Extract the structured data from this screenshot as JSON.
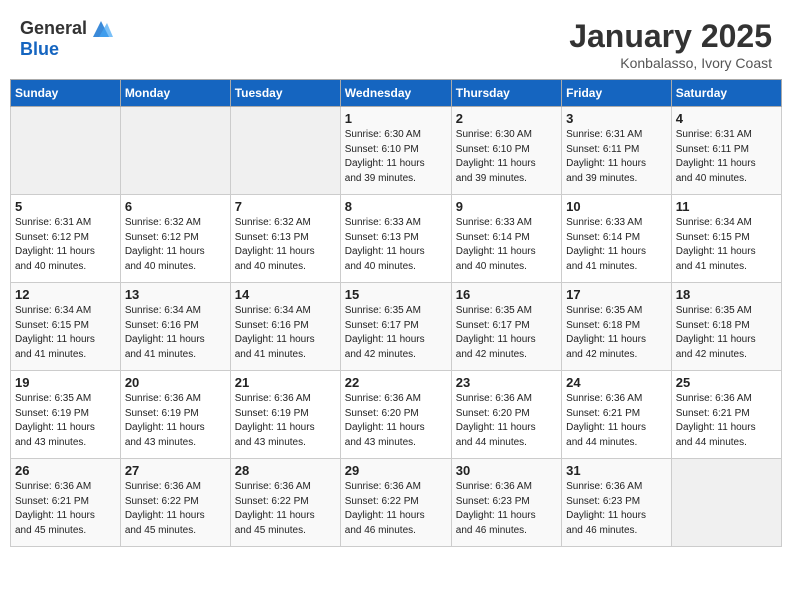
{
  "header": {
    "logo_general": "General",
    "logo_blue": "Blue",
    "month": "January 2025",
    "location": "Konbalasso, Ivory Coast"
  },
  "weekdays": [
    "Sunday",
    "Monday",
    "Tuesday",
    "Wednesday",
    "Thursday",
    "Friday",
    "Saturday"
  ],
  "weeks": [
    [
      {
        "day": "",
        "detail": ""
      },
      {
        "day": "",
        "detail": ""
      },
      {
        "day": "",
        "detail": ""
      },
      {
        "day": "1",
        "detail": "Sunrise: 6:30 AM\nSunset: 6:10 PM\nDaylight: 11 hours\nand 39 minutes."
      },
      {
        "day": "2",
        "detail": "Sunrise: 6:30 AM\nSunset: 6:10 PM\nDaylight: 11 hours\nand 39 minutes."
      },
      {
        "day": "3",
        "detail": "Sunrise: 6:31 AM\nSunset: 6:11 PM\nDaylight: 11 hours\nand 39 minutes."
      },
      {
        "day": "4",
        "detail": "Sunrise: 6:31 AM\nSunset: 6:11 PM\nDaylight: 11 hours\nand 40 minutes."
      }
    ],
    [
      {
        "day": "5",
        "detail": "Sunrise: 6:31 AM\nSunset: 6:12 PM\nDaylight: 11 hours\nand 40 minutes."
      },
      {
        "day": "6",
        "detail": "Sunrise: 6:32 AM\nSunset: 6:12 PM\nDaylight: 11 hours\nand 40 minutes."
      },
      {
        "day": "7",
        "detail": "Sunrise: 6:32 AM\nSunset: 6:13 PM\nDaylight: 11 hours\nand 40 minutes."
      },
      {
        "day": "8",
        "detail": "Sunrise: 6:33 AM\nSunset: 6:13 PM\nDaylight: 11 hours\nand 40 minutes."
      },
      {
        "day": "9",
        "detail": "Sunrise: 6:33 AM\nSunset: 6:14 PM\nDaylight: 11 hours\nand 40 minutes."
      },
      {
        "day": "10",
        "detail": "Sunrise: 6:33 AM\nSunset: 6:14 PM\nDaylight: 11 hours\nand 41 minutes."
      },
      {
        "day": "11",
        "detail": "Sunrise: 6:34 AM\nSunset: 6:15 PM\nDaylight: 11 hours\nand 41 minutes."
      }
    ],
    [
      {
        "day": "12",
        "detail": "Sunrise: 6:34 AM\nSunset: 6:15 PM\nDaylight: 11 hours\nand 41 minutes."
      },
      {
        "day": "13",
        "detail": "Sunrise: 6:34 AM\nSunset: 6:16 PM\nDaylight: 11 hours\nand 41 minutes."
      },
      {
        "day": "14",
        "detail": "Sunrise: 6:34 AM\nSunset: 6:16 PM\nDaylight: 11 hours\nand 41 minutes."
      },
      {
        "day": "15",
        "detail": "Sunrise: 6:35 AM\nSunset: 6:17 PM\nDaylight: 11 hours\nand 42 minutes."
      },
      {
        "day": "16",
        "detail": "Sunrise: 6:35 AM\nSunset: 6:17 PM\nDaylight: 11 hours\nand 42 minutes."
      },
      {
        "day": "17",
        "detail": "Sunrise: 6:35 AM\nSunset: 6:18 PM\nDaylight: 11 hours\nand 42 minutes."
      },
      {
        "day": "18",
        "detail": "Sunrise: 6:35 AM\nSunset: 6:18 PM\nDaylight: 11 hours\nand 42 minutes."
      }
    ],
    [
      {
        "day": "19",
        "detail": "Sunrise: 6:35 AM\nSunset: 6:19 PM\nDaylight: 11 hours\nand 43 minutes."
      },
      {
        "day": "20",
        "detail": "Sunrise: 6:36 AM\nSunset: 6:19 PM\nDaylight: 11 hours\nand 43 minutes."
      },
      {
        "day": "21",
        "detail": "Sunrise: 6:36 AM\nSunset: 6:19 PM\nDaylight: 11 hours\nand 43 minutes."
      },
      {
        "day": "22",
        "detail": "Sunrise: 6:36 AM\nSunset: 6:20 PM\nDaylight: 11 hours\nand 43 minutes."
      },
      {
        "day": "23",
        "detail": "Sunrise: 6:36 AM\nSunset: 6:20 PM\nDaylight: 11 hours\nand 44 minutes."
      },
      {
        "day": "24",
        "detail": "Sunrise: 6:36 AM\nSunset: 6:21 PM\nDaylight: 11 hours\nand 44 minutes."
      },
      {
        "day": "25",
        "detail": "Sunrise: 6:36 AM\nSunset: 6:21 PM\nDaylight: 11 hours\nand 44 minutes."
      }
    ],
    [
      {
        "day": "26",
        "detail": "Sunrise: 6:36 AM\nSunset: 6:21 PM\nDaylight: 11 hours\nand 45 minutes."
      },
      {
        "day": "27",
        "detail": "Sunrise: 6:36 AM\nSunset: 6:22 PM\nDaylight: 11 hours\nand 45 minutes."
      },
      {
        "day": "28",
        "detail": "Sunrise: 6:36 AM\nSunset: 6:22 PM\nDaylight: 11 hours\nand 45 minutes."
      },
      {
        "day": "29",
        "detail": "Sunrise: 6:36 AM\nSunset: 6:22 PM\nDaylight: 11 hours\nand 46 minutes."
      },
      {
        "day": "30",
        "detail": "Sunrise: 6:36 AM\nSunset: 6:23 PM\nDaylight: 11 hours\nand 46 minutes."
      },
      {
        "day": "31",
        "detail": "Sunrise: 6:36 AM\nSunset: 6:23 PM\nDaylight: 11 hours\nand 46 minutes."
      },
      {
        "day": "",
        "detail": ""
      }
    ]
  ]
}
